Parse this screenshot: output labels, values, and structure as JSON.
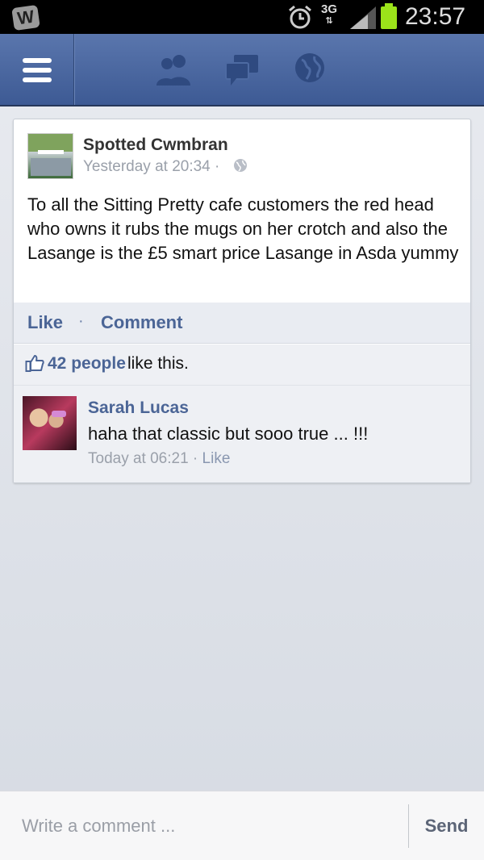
{
  "status_bar": {
    "app_badge": "W",
    "network": "3G",
    "time": "23:57"
  },
  "header": {
    "icons": [
      "menu-icon",
      "friends-icon",
      "messages-icon",
      "notifications-globe-icon"
    ]
  },
  "post": {
    "page_name": "Spotted Cwmbran",
    "timestamp": "Yesterday at 20:34 ·",
    "privacy_icon": "globe-icon",
    "body": "To all the Sitting Pretty cafe customers the red head who owns it rubs the mugs on her crotch and also the Lasange is the £5 smart price Lasange in Asda yummy",
    "actions": {
      "like_label": "Like",
      "separator": "·",
      "comment_label": "Comment"
    },
    "likes": {
      "count_label": "42 people",
      "suffix": "like this."
    },
    "comments": [
      {
        "author": "Sarah Lucas",
        "text": "haha that classic but sooo true ... !!!",
        "time": "Today at 06:21 ·",
        "like_label": "Like"
      }
    ]
  },
  "composer": {
    "placeholder": "Write a comment ...",
    "send_label": "Send"
  },
  "colors": {
    "header_blue": "#4b6aa3",
    "link_blue": "#4b6596",
    "battery_green": "#9be31a"
  }
}
